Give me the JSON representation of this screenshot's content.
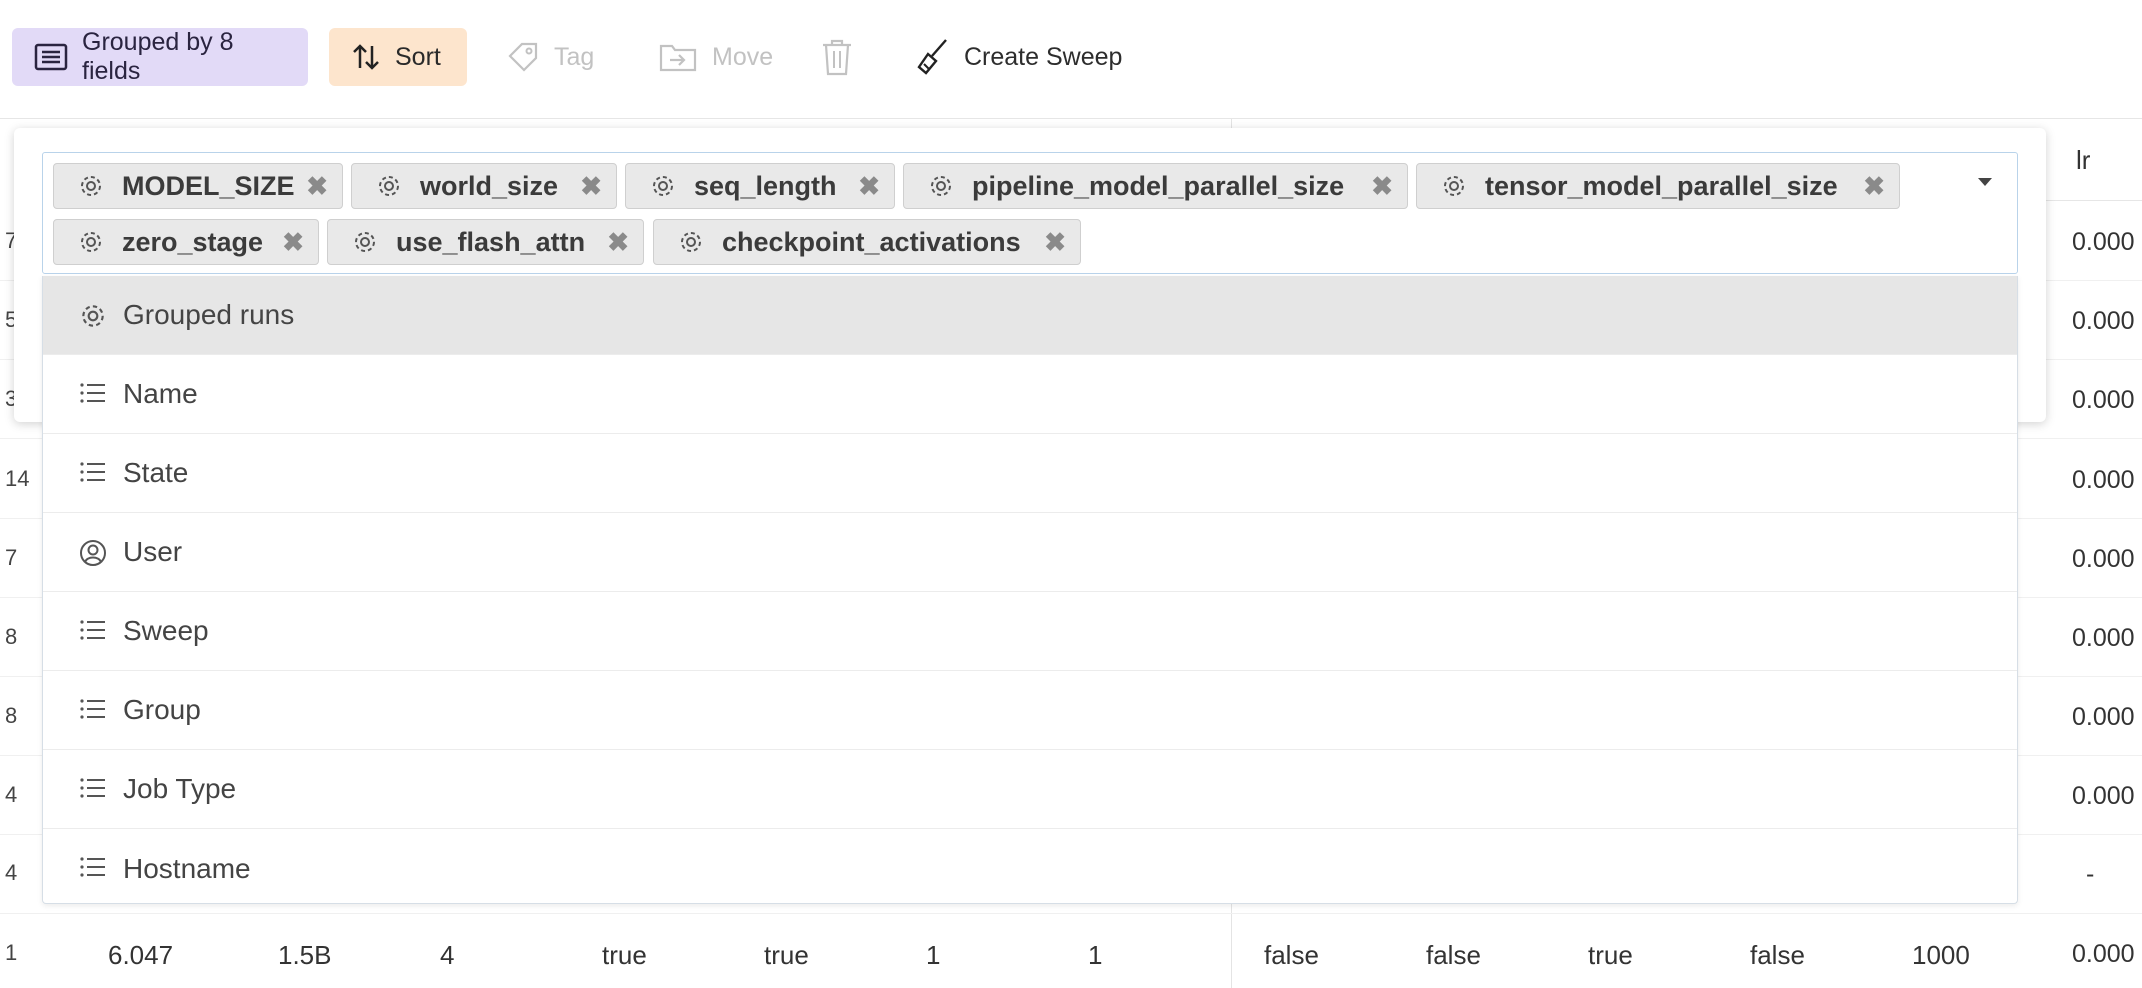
{
  "toolbar": {
    "grouped_label": "Grouped by 8 fields",
    "sort_label": "Sort",
    "tag_label": "Tag",
    "move_label": "Move",
    "create_sweep_label": "Create Sweep"
  },
  "group_chips": [
    {
      "label": "MODEL_SIZE"
    },
    {
      "label": "world_size"
    },
    {
      "label": "seq_length"
    },
    {
      "label": "pipeline_model_parallel_size"
    },
    {
      "label": "tensor_model_parallel_size"
    },
    {
      "label": "zero_stage"
    },
    {
      "label": "use_flash_attn"
    },
    {
      "label": "checkpoint_activations"
    }
  ],
  "dropdown": {
    "items": [
      {
        "label": "Grouped runs",
        "icon": "gear-icon"
      },
      {
        "label": "Name",
        "icon": "list-icon"
      },
      {
        "label": "State",
        "icon": "list-icon"
      },
      {
        "label": "User",
        "icon": "user-icon"
      },
      {
        "label": "Sweep",
        "icon": "list-icon"
      },
      {
        "label": "Group",
        "icon": "list-icon"
      },
      {
        "label": "Job Type",
        "icon": "list-icon"
      },
      {
        "label": "Hostname",
        "icon": "list-icon"
      }
    ]
  },
  "table": {
    "lr_header": "lr",
    "row_counts": [
      "7",
      "5",
      "3",
      "14",
      "7",
      "8",
      "8",
      "4",
      "4",
      "1"
    ],
    "lr_values": [
      "0.000",
      "0.000",
      "0.000",
      "0.000",
      "0.000",
      "0.000",
      "0.000",
      "0.000",
      "-",
      "0.000"
    ],
    "last_row": [
      "6.047",
      "1.5B",
      "4",
      "true",
      "true",
      "1",
      "1",
      "false",
      "false",
      "true",
      "false",
      "1000"
    ]
  },
  "colors": {
    "grouped_bg": "#e2daf7",
    "sort_bg": "#fde5cd",
    "active_row": "#e6e6e6"
  }
}
